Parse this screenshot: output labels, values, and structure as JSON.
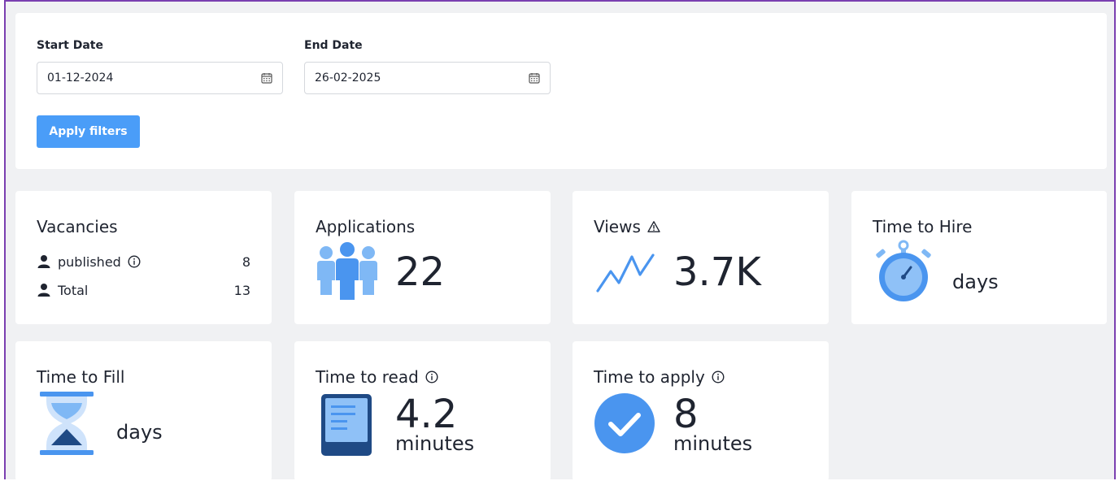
{
  "filters": {
    "start_label": "Start Date",
    "start_value": "01-12-2024",
    "end_label": "End Date",
    "end_value": "26-02-2025",
    "apply_label": "Apply filters"
  },
  "cards": {
    "vacancies": {
      "title": "Vacancies",
      "rows": [
        {
          "label": "published",
          "value": "8",
          "icon": "user-icon",
          "info": true
        },
        {
          "label": "Total",
          "value": "13",
          "icon": "user-icon",
          "info": false
        }
      ]
    },
    "applications": {
      "title": "Applications",
      "value": "22",
      "icon": "people-group-icon"
    },
    "views": {
      "title": "Views",
      "value": "3.7K",
      "icon": "trend-line-icon",
      "badge": "warning-icon"
    },
    "time_to_hire": {
      "title": "Time to Hire",
      "unit": "days",
      "icon": "stopwatch-icon"
    },
    "time_to_fill": {
      "title": "Time to Fill",
      "unit": "days",
      "icon": "hourglass-icon"
    },
    "time_to_read": {
      "title": "Time to read",
      "value": "4.2",
      "unit": "minutes",
      "icon": "document-reader-icon"
    },
    "time_to_apply": {
      "title": "Time to apply",
      "value": "8",
      "unit": "minutes",
      "icon": "check-circle-icon"
    }
  },
  "colors": {
    "accent": "#4a9df8",
    "frame": "#7a3fb0",
    "background": "#f0f1f3",
    "icon_blue": "#4a95ef",
    "icon_light_blue": "#7fb8f5",
    "icon_dark_blue": "#1f4a85"
  }
}
